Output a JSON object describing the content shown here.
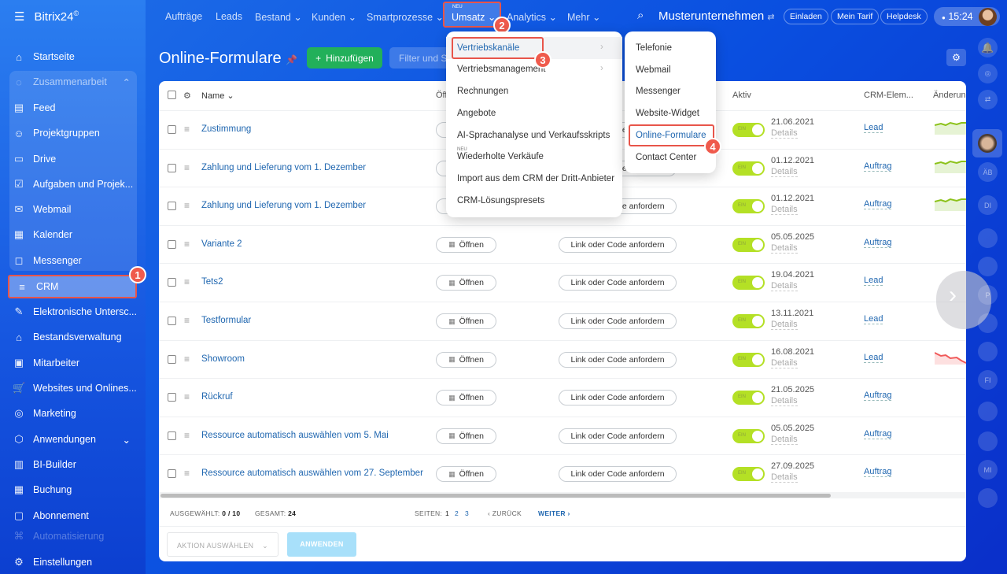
{
  "app": {
    "logo": "Bitrix24",
    "logo_mark": "©"
  },
  "sidebar": {
    "items": [
      {
        "label": "Startseite",
        "icon": "⌂"
      },
      {
        "label": "Zusammenarbeit",
        "icon": "◌"
      },
      {
        "label": "Feed",
        "icon": "▤"
      },
      {
        "label": "Projektgruppen",
        "icon": "☺"
      },
      {
        "label": "Drive",
        "icon": "▭"
      },
      {
        "label": "Aufgaben und Projek...",
        "icon": "☑"
      },
      {
        "label": "Webmail",
        "icon": "✉"
      },
      {
        "label": "Kalender",
        "icon": "▦"
      },
      {
        "label": "Messenger",
        "icon": "◻"
      },
      {
        "label": "CRM",
        "icon": "≡"
      },
      {
        "label": "Elektronische Untersc...",
        "icon": "✎"
      },
      {
        "label": "Bestandsverwaltung",
        "icon": "⌂"
      },
      {
        "label": "Mitarbeiter",
        "icon": "▣"
      },
      {
        "label": "Websites und Onlines...",
        "icon": "🛒"
      },
      {
        "label": "Marketing",
        "icon": "◎"
      },
      {
        "label": "Anwendungen",
        "icon": "⬡"
      },
      {
        "label": "BI-Builder",
        "icon": "▥"
      },
      {
        "label": "Buchung",
        "icon": "▦"
      },
      {
        "label": "Abonnement",
        "icon": "▢"
      },
      {
        "label": "Automatisierung",
        "icon": "⌘"
      },
      {
        "label": "Einstellungen",
        "icon": "⚙"
      }
    ]
  },
  "topnav": {
    "items": [
      "Aufträge",
      "Leads",
      "Bestand",
      "Kunden",
      "Smartprozesse",
      "Umsatz",
      "Analytics",
      "Mehr"
    ],
    "new_tag": "NEU",
    "company": "Musterunternehmen",
    "invite": "Einladen",
    "tariff": "Mein Tarif",
    "helpdesk": "Helpdesk",
    "time": "15:24"
  },
  "page": {
    "title": "Online-Formulare",
    "add": "Hinzufügen",
    "filter_placeholder": "Filter und Suche"
  },
  "table": {
    "headers": {
      "name": "Name",
      "open": "Öffnen",
      "active": "Aktiv",
      "crm": "CRM-Elem...",
      "change": "Änderung"
    },
    "open_label": "Öffnen",
    "link_label": "Link oder Code anfordern",
    "toggle_label": "EIN",
    "details_label": "Details",
    "rows": [
      {
        "name": "Zustimmung",
        "date": "21.06.2021",
        "crm": "Lead",
        "trend": "up"
      },
      {
        "name": "Zahlung und Lieferung vom 1. Dezember",
        "date": "01.12.2021",
        "crm": "Auftrag",
        "trend": "up"
      },
      {
        "name": "Zahlung und Lieferung vom 1. Dezember",
        "date": "01.12.2021",
        "crm": "Auftrag",
        "trend": "up"
      },
      {
        "name": "Variante 2",
        "date": "05.05.2025",
        "crm": "Auftrag",
        "trend": ""
      },
      {
        "name": "Tets2",
        "date": "19.04.2021",
        "crm": "Lead",
        "trend": ""
      },
      {
        "name": "Testformular",
        "date": "13.11.2021",
        "crm": "Lead",
        "trend": ""
      },
      {
        "name": "Showroom",
        "date": "16.08.2021",
        "crm": "Lead",
        "trend": "down"
      },
      {
        "name": "Rückruf",
        "date": "21.05.2025",
        "crm": "Auftrag",
        "trend": ""
      },
      {
        "name": "Ressource automatisch auswählen vom 5. Mai",
        "date": "05.05.2025",
        "crm": "Auftrag",
        "trend": ""
      },
      {
        "name": "Ressource automatisch auswählen vom 27. September",
        "date": "27.09.2025",
        "crm": "Auftrag",
        "trend": ""
      }
    ]
  },
  "footer": {
    "selected_label": "AUSGEWÄHLT:",
    "selected": "0 / 10",
    "total_label": "GESAMT:",
    "total": "24",
    "pages_label": "SEITEN:",
    "pages": [
      "1",
      "2",
      "3"
    ],
    "back": "ZURÜCK",
    "next": "WEITER",
    "action": "AKTION AUSWÄHLEN",
    "apply": "ANWENDEN"
  },
  "umsatz_menu": {
    "items": [
      "Vertriebskanäle",
      "Vertriebsmanagement",
      "Rechnungen",
      "Angebote",
      "AI-Sprachanalyse und Verkaufsskripts",
      "Wiederholte Verkäufe",
      "Import aus dem CRM der Dritt-Anbieter",
      "CRM-Lösungspresets"
    ],
    "new_tag": "NEU"
  },
  "channels_menu": {
    "items": [
      "Telefonie",
      "Webmail",
      "Messenger",
      "Website-Widget",
      "Online-Formulare",
      "Contact Center"
    ]
  },
  "steps": [
    "1",
    "2",
    "3",
    "4"
  ],
  "rail": {
    "items": [
      "ÄB",
      "DI",
      "",
      "",
      "P",
      "",
      "",
      "FI",
      "",
      "",
      "MI",
      ""
    ]
  },
  "colors": {
    "accent": "#2067b0",
    "toggle": "#b4e025",
    "highlight": "#e8554a",
    "add": "#22b05a"
  }
}
